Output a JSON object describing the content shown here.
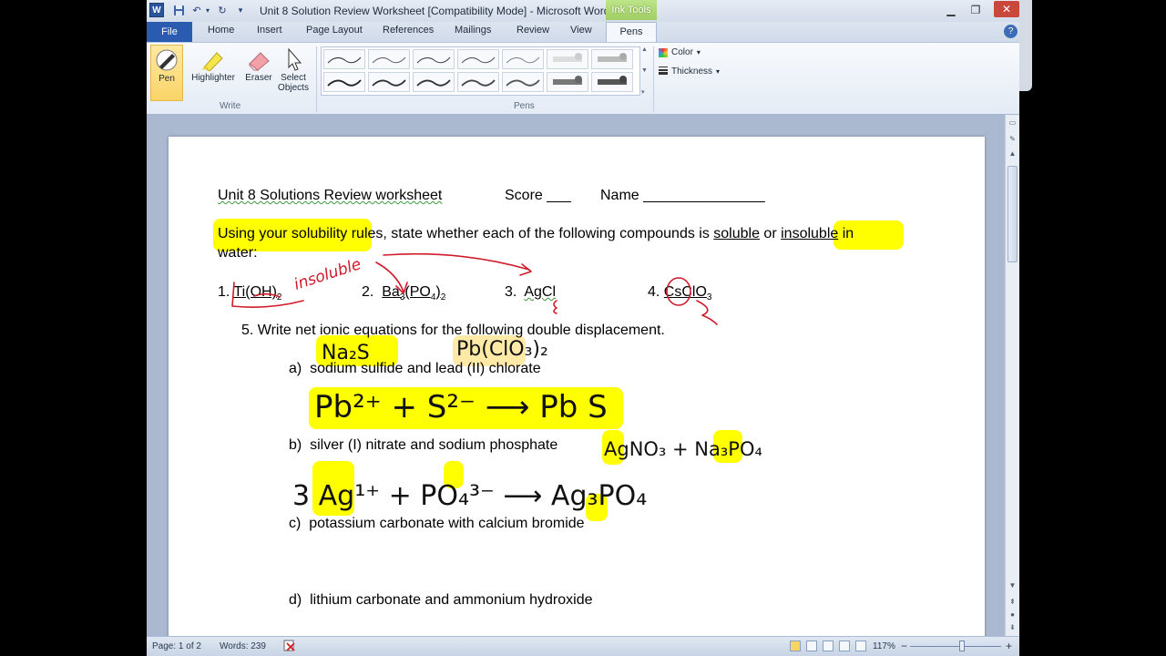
{
  "window": {
    "title": "Unit 8 Solution Review Worksheet [Compatibility Mode]  -  Microsoft Word",
    "contextual_tab_group": "Ink Tools",
    "controls": {
      "minimize": "▁",
      "maximize": "❐",
      "close": "✕"
    }
  },
  "quick_access": {
    "logo": "W",
    "save": "💾",
    "undo": "↶",
    "redo": "↻",
    "customize": "▾"
  },
  "tabs": [
    "Home",
    "Insert",
    "Page Layout",
    "References",
    "Mailings",
    "Review",
    "View"
  ],
  "file_tab": "File",
  "active_tab": "Pens",
  "help_glyph": "?",
  "ribbon": {
    "write_group": {
      "label": "Write",
      "buttons": [
        {
          "label": "Pen",
          "icon": "pen-icon"
        },
        {
          "label": "Highlighter",
          "icon": "highlighter-icon"
        },
        {
          "label": "Eraser",
          "icon": "eraser-icon"
        },
        {
          "label": "Select Objects",
          "icon": "arrow-cursor-icon"
        }
      ]
    },
    "pens_group": {
      "label": "Pens"
    },
    "options": {
      "color_label": "Color",
      "thickness_label": "Thickness",
      "dropdown_glyph": "▾"
    }
  },
  "document": {
    "header_line": {
      "title": "Unit 8 Solutions  Review worksheet",
      "score": "Score ___",
      "name": "Name _______________"
    },
    "instruction": {
      "pre": "Using your solubility rules, state whether each of the following compounds is ",
      "soluble": "soluble",
      "or": " or ",
      "insoluble": "insoluble",
      "post": " in",
      "line2": "water:"
    },
    "compounds": [
      {
        "num": "1.",
        "formula": "Ti(OH)",
        "sub": "2"
      },
      {
        "num": "2.",
        "a": "Ba",
        "s1": "3",
        "b": "(PO",
        "s2": "4",
        "c": ")",
        "s3": "2"
      },
      {
        "num": "3.",
        "formula": "AgCl"
      },
      {
        "num": "4.",
        "formula": "CsClO",
        "sub": "3"
      }
    ],
    "q5": "5.   Write net ionic equations for the following double displacement.",
    "parts": [
      {
        "letter": "a)",
        "text": "sodium sulfide and lead (II) chlorate"
      },
      {
        "letter": "b)",
        "text": "silver (I) nitrate and sodium phosphate"
      },
      {
        "letter": "c)",
        "text": "potassium carbonate with calcium bromide"
      },
      {
        "letter": "d)",
        "text": "lithium carbonate and ammonium hydroxide"
      }
    ],
    "handwriting": {
      "insoluble_note": "insoluble",
      "na2s": "Na₂S",
      "pbclo": "Pb(ClO₃)₂",
      "eq_a": "Pb²⁺  +  S²⁻  ⟶  Pb S",
      "b_formula": "AgNO₃ + Na₃PO₄",
      "eq_b": "3 Ag¹⁺  +  PO₄³⁻  ⟶  Ag₃PO₄"
    }
  },
  "status": {
    "page": "Page: 1 of 2",
    "words": "Words: 239",
    "zoom": "117%",
    "zoom_minus": "−",
    "zoom_plus": "+"
  }
}
